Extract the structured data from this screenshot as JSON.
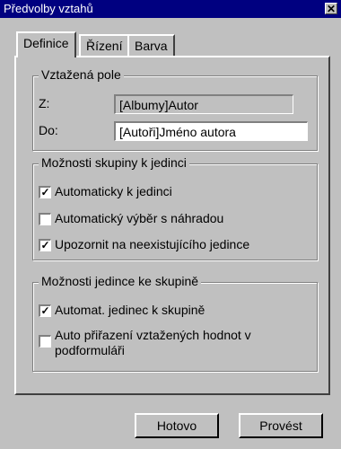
{
  "window": {
    "title": "Předvolby vztahů",
    "close_glyph": "✕"
  },
  "tabs": [
    {
      "label": "Definice",
      "active": true
    },
    {
      "label": "Řízení",
      "active": false
    },
    {
      "label": "Barva",
      "active": false
    }
  ],
  "related_field": {
    "title": "Vztažená pole",
    "from_label": "Z:",
    "from_value": "[Albumy]Autor",
    "to_label": "Do:",
    "to_value": "[Autoři]Jméno autora"
  },
  "group_to_individual": {
    "title": "Možnosti skupiny k jedinci",
    "options": [
      {
        "label": "Automaticky k jedinci",
        "checked": true
      },
      {
        "label": "Automatický výběr s náhradou",
        "checked": false
      },
      {
        "label": "Upozornit na neexistujícího jedince",
        "checked": true
      }
    ]
  },
  "individual_to_group": {
    "title": "Možnosti jedince ke skupině",
    "options": [
      {
        "label": "Automat. jedinec k skupině",
        "checked": true
      },
      {
        "label": "Auto přiřazení vztažených hodnot v",
        "label2": "podformuláři",
        "checked": false
      }
    ]
  },
  "buttons": {
    "done": "Hotovo",
    "apply": "Provést"
  },
  "check_glyph": "✓"
}
